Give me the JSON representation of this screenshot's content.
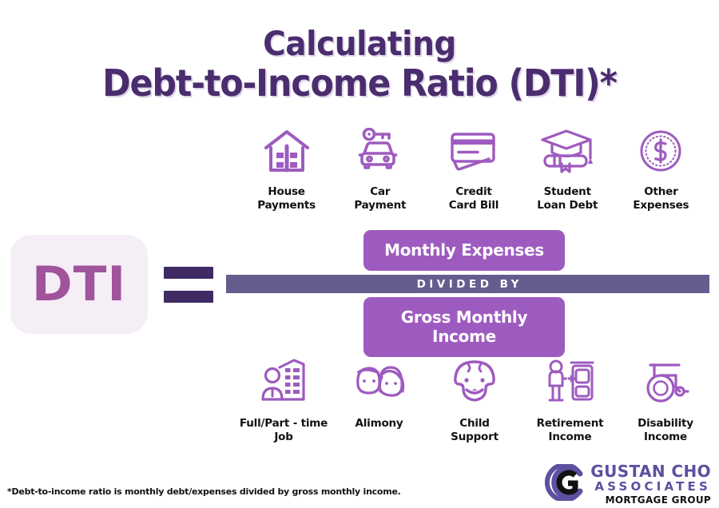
{
  "title": {
    "line1": "Calculating",
    "line2": "Debt-to-Income Ratio (DTI)*",
    "color": "#4A2D6E"
  },
  "colors": {
    "icon_purple": "#9E5BBF",
    "pill_purple": "#9E5BBF",
    "divider_slate": "#645D8D",
    "equals_dark": "#3F2A63",
    "dti_text": "#A0549B",
    "dti_bg": "#F5EEF7",
    "logo_purple": "#5D50A0",
    "label_black": "#14110F"
  },
  "expenses_row": [
    {
      "icon": "house-icon",
      "label": "House\nPayments"
    },
    {
      "icon": "car-key-icon",
      "label": "Car\nPayment"
    },
    {
      "icon": "credit-card-icon",
      "label": "Credit\nCard Bill"
    },
    {
      "icon": "graduation-cap-diploma-icon",
      "label": "Student\nLoan Debt"
    },
    {
      "icon": "dollar-coin-icon",
      "label": "Other\nExpenses"
    }
  ],
  "income_row": [
    {
      "icon": "office-worker-icon",
      "label": "Full/Part - time\nJob"
    },
    {
      "icon": "couple-icon",
      "label": "Alimony"
    },
    {
      "icon": "baby-face-icon",
      "label": "Child\nSupport"
    },
    {
      "icon": "retirement-person-icon",
      "label": "Retirement\nIncome"
    },
    {
      "icon": "wheelchair-icon",
      "label": "Disability\nIncome"
    }
  ],
  "formula": {
    "dti_label": "DTI",
    "equals_symbol": "=",
    "numerator": "Monthly Expenses",
    "divider": "DIVIDED BY",
    "denominator": "Gross Monthly Income"
  },
  "footnote": "*Debt-to-income ratio is monthly debt/expenses divided by gross monthly income.",
  "logo": {
    "line1": "GUSTAN CHO",
    "line2": "ASSOCIATES",
    "line3": "MORTGAGE GROUP"
  }
}
